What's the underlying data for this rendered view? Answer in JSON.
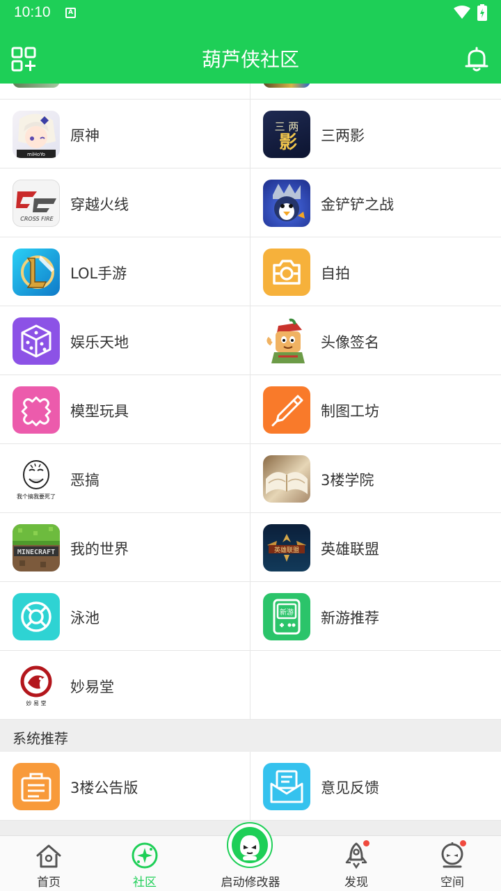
{
  "status_bar": {
    "time": "10:10",
    "notification_letter": "A"
  },
  "app_bar": {
    "title": "葫芦侠社区"
  },
  "rows": [
    {
      "left": {
        "label": "原神",
        "icon": "genshin-icon"
      },
      "right": {
        "label": "三两影",
        "icon": "sanliangying-icon"
      }
    },
    {
      "left": {
        "label": "穿越火线",
        "icon": "crossfire-icon"
      },
      "right": {
        "label": "金铲铲之战",
        "icon": "jinchanchan-icon"
      }
    },
    {
      "left": {
        "label": "LOL手游",
        "icon": "lol-mobile-icon"
      },
      "right": {
        "label": "自拍",
        "icon": "camera-icon"
      }
    },
    {
      "left": {
        "label": "娱乐天地",
        "icon": "dice-icon"
      },
      "right": {
        "label": "头像签名",
        "icon": "avatar-cartoon-icon"
      }
    },
    {
      "left": {
        "label": "模型玩具",
        "icon": "puzzle-icon"
      },
      "right": {
        "label": "制图工坊",
        "icon": "pen-icon"
      }
    },
    {
      "left": {
        "label": "恶搞",
        "icon": "meme-face-icon"
      },
      "right": {
        "label": "3楼学院",
        "icon": "book-icon"
      }
    },
    {
      "left": {
        "label": "我的世界",
        "icon": "minecraft-icon"
      },
      "right": {
        "label": "英雄联盟",
        "icon": "lol-icon"
      }
    },
    {
      "left": {
        "label": "泳池",
        "icon": "lifebuoy-icon"
      },
      "right": {
        "label": "新游推荐",
        "icon": "new-game-icon"
      }
    },
    {
      "left": {
        "label": "妙易堂",
        "icon": "miaoyitang-icon"
      },
      "right": null
    }
  ],
  "icon_texts": {
    "genshin_tag": "miHoYo",
    "sanliangying_top": "三 两",
    "sanliangying_bottom": "影",
    "new_game": "新游",
    "miaoyitang": "妙 易 堂",
    "meme_caption": "我个搞我要死了",
    "minecraft": "MINECRAFT",
    "crossfire": "CROSS FIRE",
    "lol_banner": "英雄联盟"
  },
  "system_section": {
    "header": "系统推荐",
    "items": [
      {
        "label": "3楼公告版",
        "icon": "announcement-icon"
      },
      {
        "label": "意见反馈",
        "icon": "feedback-icon"
      }
    ]
  },
  "tab_bar": {
    "tabs": [
      {
        "label": "首页",
        "icon": "home-icon"
      },
      {
        "label": "社区",
        "icon": "community-icon"
      },
      {
        "label": "启动修改器",
        "icon": "modifier-icon"
      },
      {
        "label": "发现",
        "icon": "rocket-icon"
      },
      {
        "label": "空间",
        "icon": "profile-icon"
      }
    ],
    "active_index": 1
  },
  "colors": {
    "primary": "#1ecf57",
    "badge": "#f04a3e"
  }
}
